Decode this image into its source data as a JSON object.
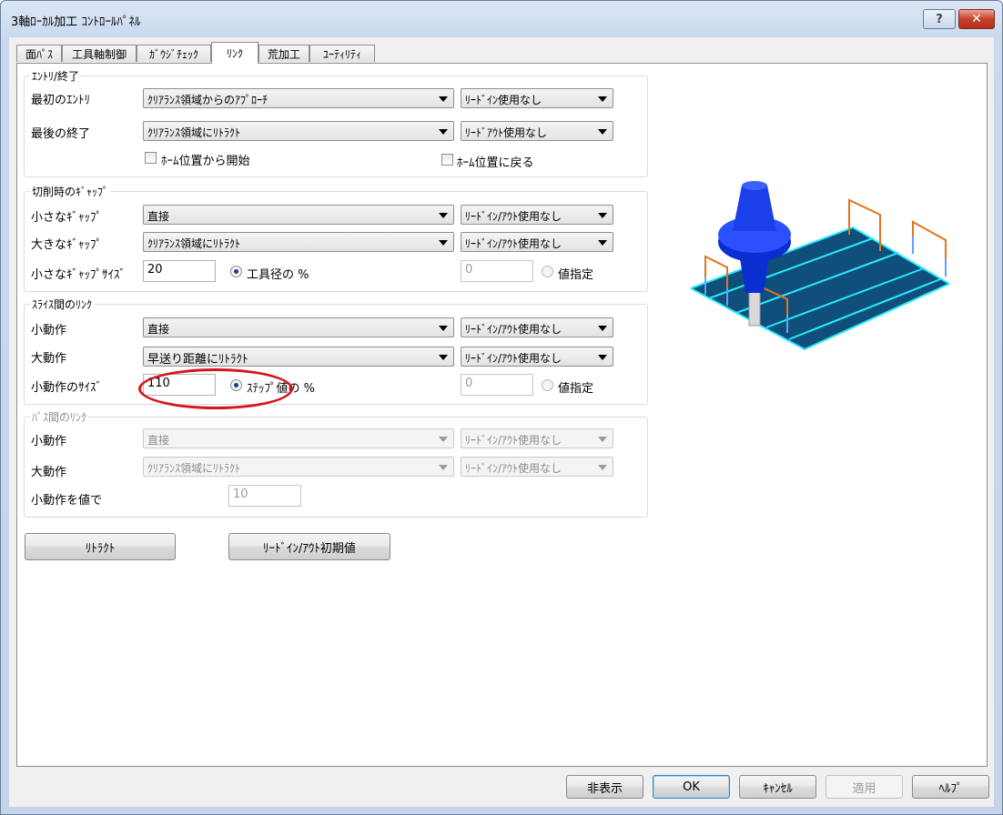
{
  "window": {
    "title": "3軸ﾛｰｶﾙ加工 ｺﾝﾄﾛｰﾙﾊﾟﾈﾙ",
    "help_label": "?",
    "close_label": "✕"
  },
  "tabs": [
    {
      "label": "面ﾊﾟｽ"
    },
    {
      "label": "工具軸制御"
    },
    {
      "label": "ｶﾞｳｼﾞﾁｪｯｸ"
    },
    {
      "label": "ﾘﾝｸ"
    },
    {
      "label": "荒加工"
    },
    {
      "label": "ﾕｰﾃｨﾘﾃｨ"
    }
  ],
  "entry_exit": {
    "title": "ｴﾝﾄﾘ/終了",
    "first_entry_label": "最初のｴﾝﾄﾘ",
    "first_entry_value": "ｸﾘｱﾗﾝｽ領域からのｱﾌﾟﾛｰﾁ",
    "lead_in_value": "ﾘｰﾄﾞｲﾝ使用なし",
    "last_exit_label": "最後の終了",
    "last_exit_value": "ｸﾘｱﾗﾝｽ領域にﾘﾄﾗｸﾄ",
    "lead_out_value": "ﾘｰﾄﾞｱｳﾄ使用なし",
    "start_home_label": "ﾎｰﾑ位置から開始",
    "return_home_label": "ﾎｰﾑ位置に戻る"
  },
  "cut_gap": {
    "title": "切削時のｷﾞｬｯﾌﾟ",
    "small_label": "小さなｷﾞｬｯﾌﾟ",
    "small_value": "直接",
    "small_lead": "ﾘｰﾄﾞｲﾝ/ｱｳﾄ使用なし",
    "large_label": "大きなｷﾞｬｯﾌﾟ",
    "large_value": "ｸﾘｱﾗﾝｽ領域にﾘﾄﾗｸﾄ",
    "large_lead": "ﾘｰﾄﾞｲﾝ/ｱｳﾄ使用なし",
    "size_label": "小さなｷﾞｬｯﾌﾟｻｲｽﾞ",
    "size_value": "20",
    "tool_dia_label": "工具径の %",
    "value_field": "0",
    "value_label": "値指定"
  },
  "slice_link": {
    "title": "ｽﾗｲｽ間のﾘﾝｸ",
    "small_label": "小動作",
    "small_value": "直接",
    "small_lead": "ﾘｰﾄﾞｲﾝ/ｱｳﾄ使用なし",
    "large_label": "大動作",
    "large_value": "早送り距離にﾘﾄﾗｸﾄ",
    "large_lead": "ﾘｰﾄﾞｲﾝ/ｱｳﾄ使用なし",
    "size_label": "小動作のｻｲｽﾞ",
    "size_value": "110",
    "step_label": "ｽﾃｯﾌﾟ値の %",
    "value_field": "0",
    "value_label": "値指定"
  },
  "pass_link": {
    "title": "ﾊﾟｽ間のﾘﾝｸ",
    "small_label": "小動作",
    "small_value": "直接",
    "small_lead": "ﾘｰﾄﾞｲﾝ/ｱｳﾄ使用なし",
    "large_label": "大動作",
    "large_value": "ｸﾘｱﾗﾝｽ領域にﾘﾄﾗｸﾄ",
    "large_lead": "ﾘｰﾄﾞｲﾝ/ｱｳﾄ使用なし",
    "value_label": "小動作を値で",
    "value_field": "10"
  },
  "actions": {
    "retract_label": "ﾘﾄﾗｸﾄ",
    "lead_default_label": "ﾘｰﾄﾞｲﾝ/ｱｳﾄ初期値"
  },
  "footer": {
    "hide_label": "非表示",
    "ok_label": "OK",
    "cancel_label": "ｷｬﾝｾﾙ",
    "apply_label": "適用",
    "help_label": "ﾍﾙﾌﾟ"
  },
  "colors": {
    "highlight_ellipse": "#d6141e",
    "tool_blue": "#0a2fd0",
    "plate": "#0f4f7a",
    "toolpath": "#29e8ff",
    "link_orange": "#e2741c"
  }
}
